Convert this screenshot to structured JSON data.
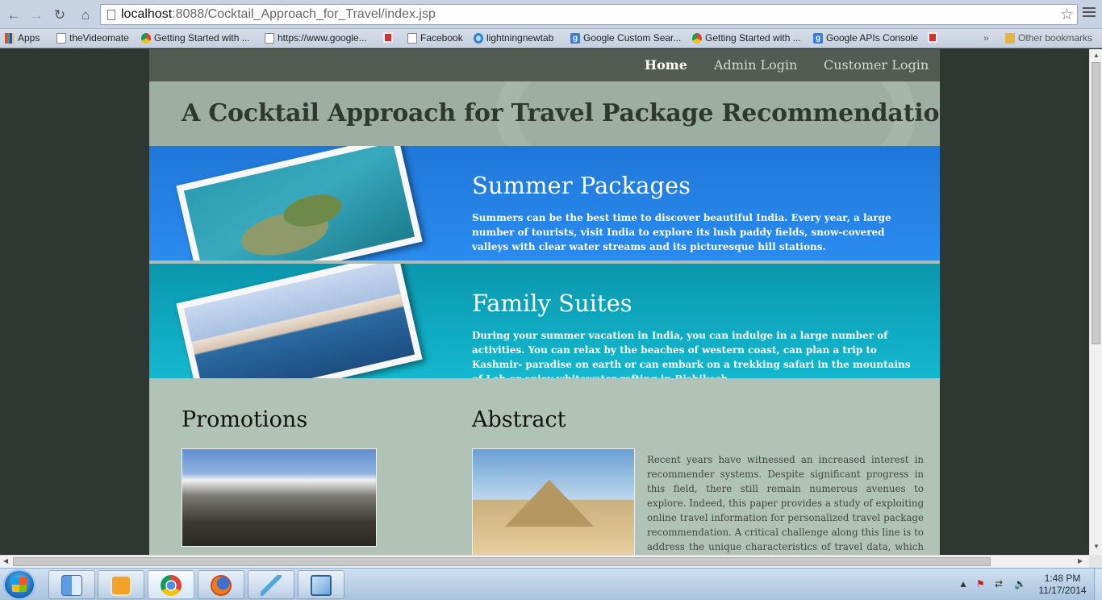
{
  "browser": {
    "url_host": "localhost",
    "url_path": ":8088/Cocktail_Approach_for_Travel/index.jsp",
    "bookmarks": [
      {
        "label": "Apps",
        "icon": "apps-grid-icon"
      },
      {
        "label": "theVideomate",
        "icon": "page-icon"
      },
      {
        "label": "Getting Started with ...",
        "icon": "chrome-icon"
      },
      {
        "label": "https://www.google...",
        "icon": "page-icon"
      },
      {
        "label": "",
        "icon": "bookmark-app-icon"
      },
      {
        "label": "Facebook",
        "icon": "page-icon"
      },
      {
        "label": "lightningnewtab",
        "icon": "lightning-newtab-icon"
      },
      {
        "label": "Google Custom Sear...",
        "icon": "google-icon"
      },
      {
        "label": "Getting Started with ...",
        "icon": "chrome-icon"
      },
      {
        "label": "Google APIs Console",
        "icon": "google-icon"
      },
      {
        "label": "",
        "icon": "bookmark-app-icon"
      }
    ],
    "overflow_label": "»",
    "other_bookmarks": "Other bookmarks"
  },
  "site": {
    "nav": [
      {
        "label": "Home",
        "active": true
      },
      {
        "label": "Admin Login",
        "active": false
      },
      {
        "label": "Customer Login",
        "active": false
      }
    ],
    "title": "A Cocktail Approach for Travel Package Recommendation",
    "features": [
      {
        "title": "Summer Packages",
        "text": "Summers can be the best time to discover beautiful India. Every year, a large number of tourists, visit India to explore its lush paddy fields, snow-covered valleys with clear water streams and its picturesque hill stations."
      },
      {
        "title": "Family Suites",
        "text": "During your summer vacation in India, you can indulge in a large number of activities. You can relax by the beaches of western coast, can plan a trip to Kashmir- paradise on earth or can embark on a trekking safari in the mountains of Leh or enjoy whitewater rafting in Rishikesh."
      }
    ],
    "promotions_title": "Promotions",
    "abstract_title": "Abstract",
    "abstract_text": "Recent years have witnessed an increased interest in recommender systems. Despite significant progress in this field, there still remain numerous avenues to explore. Indeed, this paper provides a study of exploiting online travel information for personalized travel package recommendation. A critical challenge along this line is to address the unique characteristics of travel data, which distinguish travel packages from traditional items for recommendation. To that end, in this paper, we first"
  },
  "taskbar": {
    "time": "1:48 PM",
    "date": "11/17/2014",
    "apps": [
      "finder-icon",
      "media-player-icon",
      "chrome-icon",
      "firefox-icon",
      "lightning-icon",
      "virtualbox-icon"
    ]
  },
  "colors": {
    "summer_bg": "#2a8bef",
    "family_bg": "#14b8cf",
    "nav_bg": "#545b52",
    "content_bg": "#b1c3b7"
  }
}
